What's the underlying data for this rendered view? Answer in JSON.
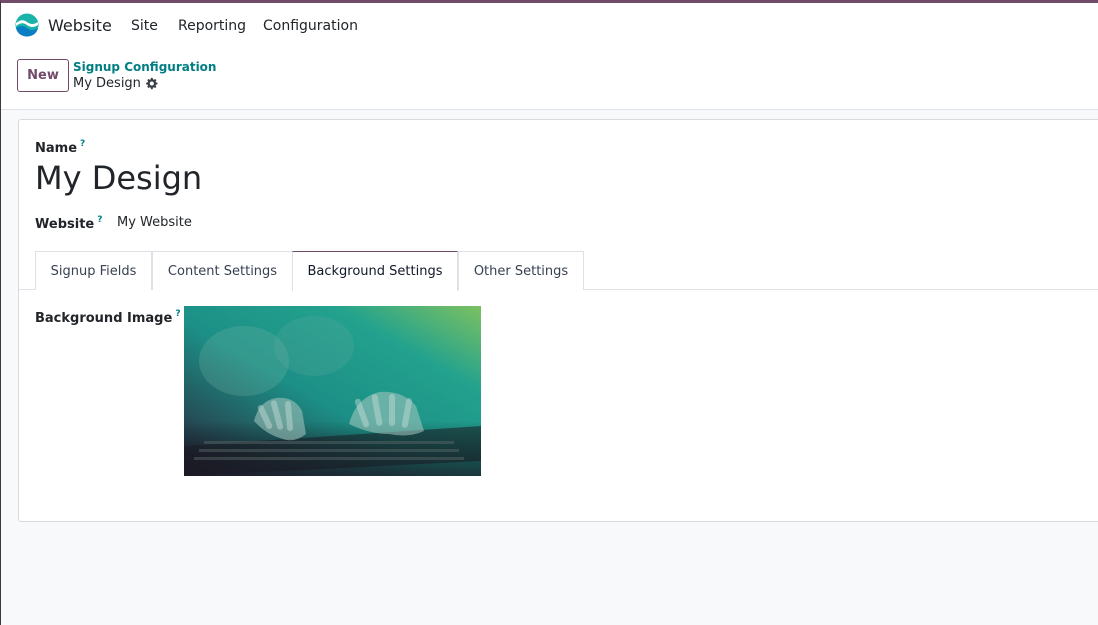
{
  "navbar": {
    "app_name": "Website",
    "menu": [
      "Site",
      "Reporting",
      "Configuration"
    ],
    "logo_colors": [
      "#1ab3a9",
      "#0a7ec2"
    ]
  },
  "control_panel": {
    "new_label": "New",
    "breadcrumb_parent": "Signup Configuration",
    "breadcrumb_current": "My Design"
  },
  "form": {
    "name_label": "Name",
    "help_mark": "?",
    "title": "My Design",
    "website_label": "Website",
    "website_value": "My Website",
    "tabs": [
      "Signup Fields",
      "Content Settings",
      "Background Settings",
      "Other Settings"
    ],
    "active_tab": "Background Settings",
    "background_image_label": "Background Image"
  },
  "colors": {
    "accent": "#714b67",
    "link": "#017e84"
  }
}
